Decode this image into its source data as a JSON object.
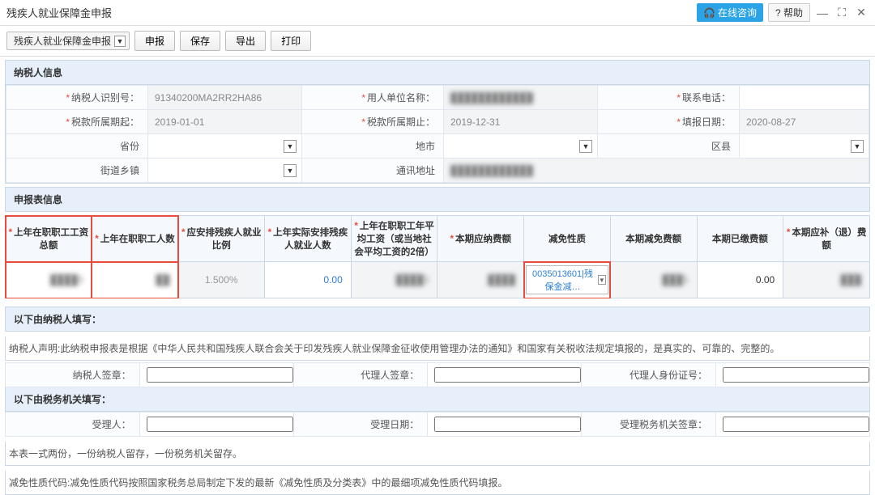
{
  "titlebar": {
    "title": "残疾人就业保障金申报",
    "online": "在线咨询",
    "help": "? 帮助"
  },
  "toolbar": {
    "breadcrumb": "残疾人就业保障金申报",
    "declare": "申报",
    "save": "保存",
    "export": "导出",
    "print": "打印"
  },
  "section_taxpayer": "纳税人信息",
  "fields": {
    "id_lbl": "纳税人识别号：",
    "id_val": "91340200MA2RR2HA86",
    "unit_lbl": "用人单位名称：",
    "unit_val": "████████████",
    "phone_lbl": "联系电话：",
    "phone_val": "",
    "period_start_lbl": "税款所属期起：",
    "period_start_val": "2019-01-01",
    "period_end_lbl": "税款所属期止：",
    "period_end_val": "2019-12-31",
    "fill_date_lbl": "填报日期：",
    "fill_date_val": "2020-08-27",
    "province_lbl": "省份",
    "city_lbl": "地市",
    "district_lbl": "区县",
    "town_lbl": "街道乡镇",
    "addr_lbl": "通讯地址",
    "addr_val": "████████████"
  },
  "section_report": "申报表信息",
  "grid": {
    "h1": "上年在职职工工资总额",
    "h2": "上年在职职工人数",
    "h3": "应安排残疾人就业比例",
    "h4": "上年实际安排残疾人就业人数",
    "h5": "上年在职职工年平均工资（或当地社会平均工资的2倍）",
    "h6": "本期应纳费额",
    "h7": "减免性质",
    "h8": "本期减免费额",
    "h9": "本期已缴费额",
    "h10": "本期应补（退）费额",
    "r1": "████0",
    "r2": "██",
    "r3": "1.500%",
    "r4": "0.00",
    "r5": "████0",
    "r6": "████",
    "r7": "0035013601|残保金减…",
    "r8": "███5",
    "r9": "0.00",
    "r10": "███"
  },
  "filler": {
    "header": "以下由纳税人填写：",
    "stmt": "纳税人声明:此纳税申报表是根据《中华人民共和国残疾人联合会关于印发残疾人就业保障金征收使用管理办法的通知》和国家有关税收法规定填报的，是真实的、可靠的、完整的。",
    "sign_lbl": "纳税人签章：",
    "agent_lbl": "代理人签章：",
    "agent_id_lbl": "代理人身份证号："
  },
  "tax_office": {
    "header": "以下由税务机关填写：",
    "accept_lbl": "受理人：",
    "date_lbl": "受理日期：",
    "stamp_lbl": "受理税务机关签章："
  },
  "footnote1": "本表一式两份，一份纳税人留存，一份税务机关留存。",
  "footnote2": "减免性质代码:减免性质代码按照国家税务总局制定下发的最新《减免性质及分类表》中的最细项减免性质代码填报。"
}
